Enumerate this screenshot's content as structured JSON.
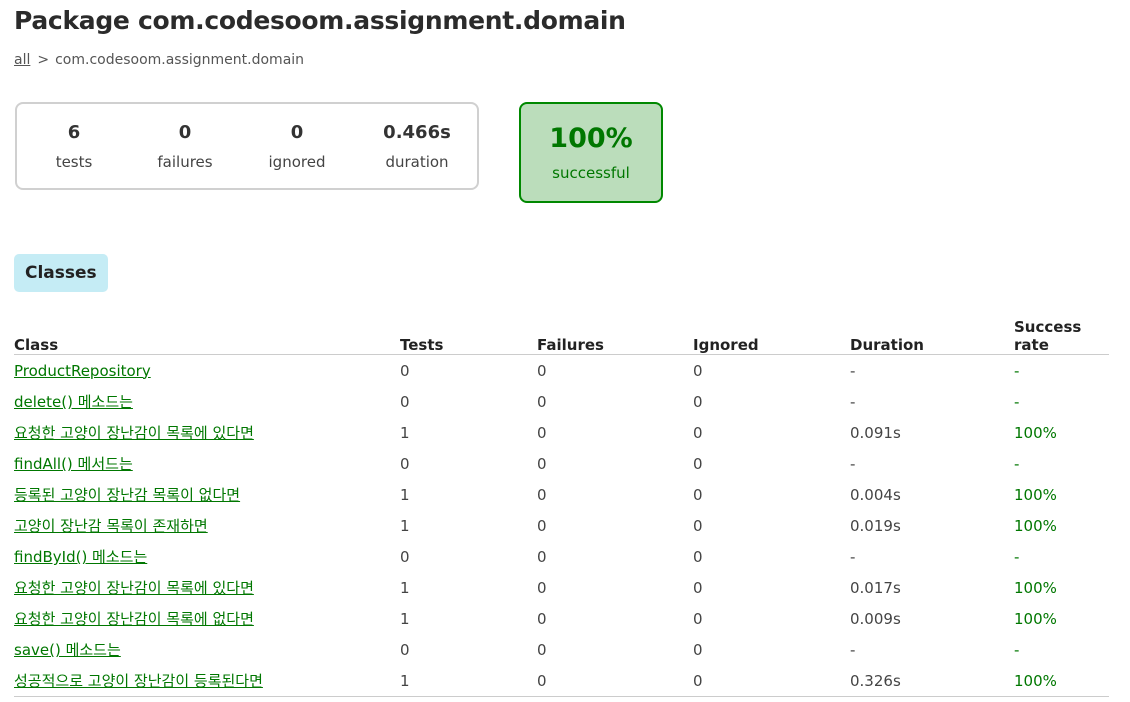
{
  "title": "Package com.codesoom.assignment.domain",
  "breadcrumb": {
    "root": "all",
    "separator": ">",
    "current": "com.codesoom.assignment.domain"
  },
  "summary": {
    "tests": {
      "value": "6",
      "label": "tests"
    },
    "failures": {
      "value": "0",
      "label": "failures"
    },
    "ignored": {
      "value": "0",
      "label": "ignored"
    },
    "duration": {
      "value": "0.466s",
      "label": "duration"
    }
  },
  "success": {
    "value": "100%",
    "label": "successful"
  },
  "tabs": [
    {
      "label": "Classes"
    }
  ],
  "table": {
    "headers": [
      "Class",
      "Tests",
      "Failures",
      "Ignored",
      "Duration",
      "Success rate"
    ],
    "rows": [
      [
        "ProductRepository",
        "0",
        "0",
        "0",
        "-",
        "-"
      ],
      [
        "delete() 메소드는",
        "0",
        "0",
        "0",
        "-",
        "-"
      ],
      [
        "요청한 고양이 장난감이 목록에 있다면",
        "1",
        "0",
        "0",
        "0.091s",
        "100%"
      ],
      [
        "findAll() 메서드는",
        "0",
        "0",
        "0",
        "-",
        "-"
      ],
      [
        "등록된 고양이 장난감 목록이 없다면",
        "1",
        "0",
        "0",
        "0.004s",
        "100%"
      ],
      [
        "고양이 장난감 목록이 존재하면",
        "1",
        "0",
        "0",
        "0.019s",
        "100%"
      ],
      [
        "findById() 메소드는",
        "0",
        "0",
        "0",
        "-",
        "-"
      ],
      [
        "요청한 고양이 장난감이 목록에 있다면",
        "1",
        "0",
        "0",
        "0.017s",
        "100%"
      ],
      [
        "요청한 고양이 장난감이 목록에 없다면",
        "1",
        "0",
        "0",
        "0.009s",
        "100%"
      ],
      [
        "save() 메소드는",
        "0",
        "0",
        "0",
        "-",
        "-"
      ],
      [
        "성공적으로 고양이 장난감이 등록된다면",
        "1",
        "0",
        "0",
        "0.326s",
        "100%"
      ]
    ]
  },
  "colors": {
    "success": "#007700",
    "success_bg": "#bbddbb",
    "tab_bg": "#c5ecf5"
  }
}
